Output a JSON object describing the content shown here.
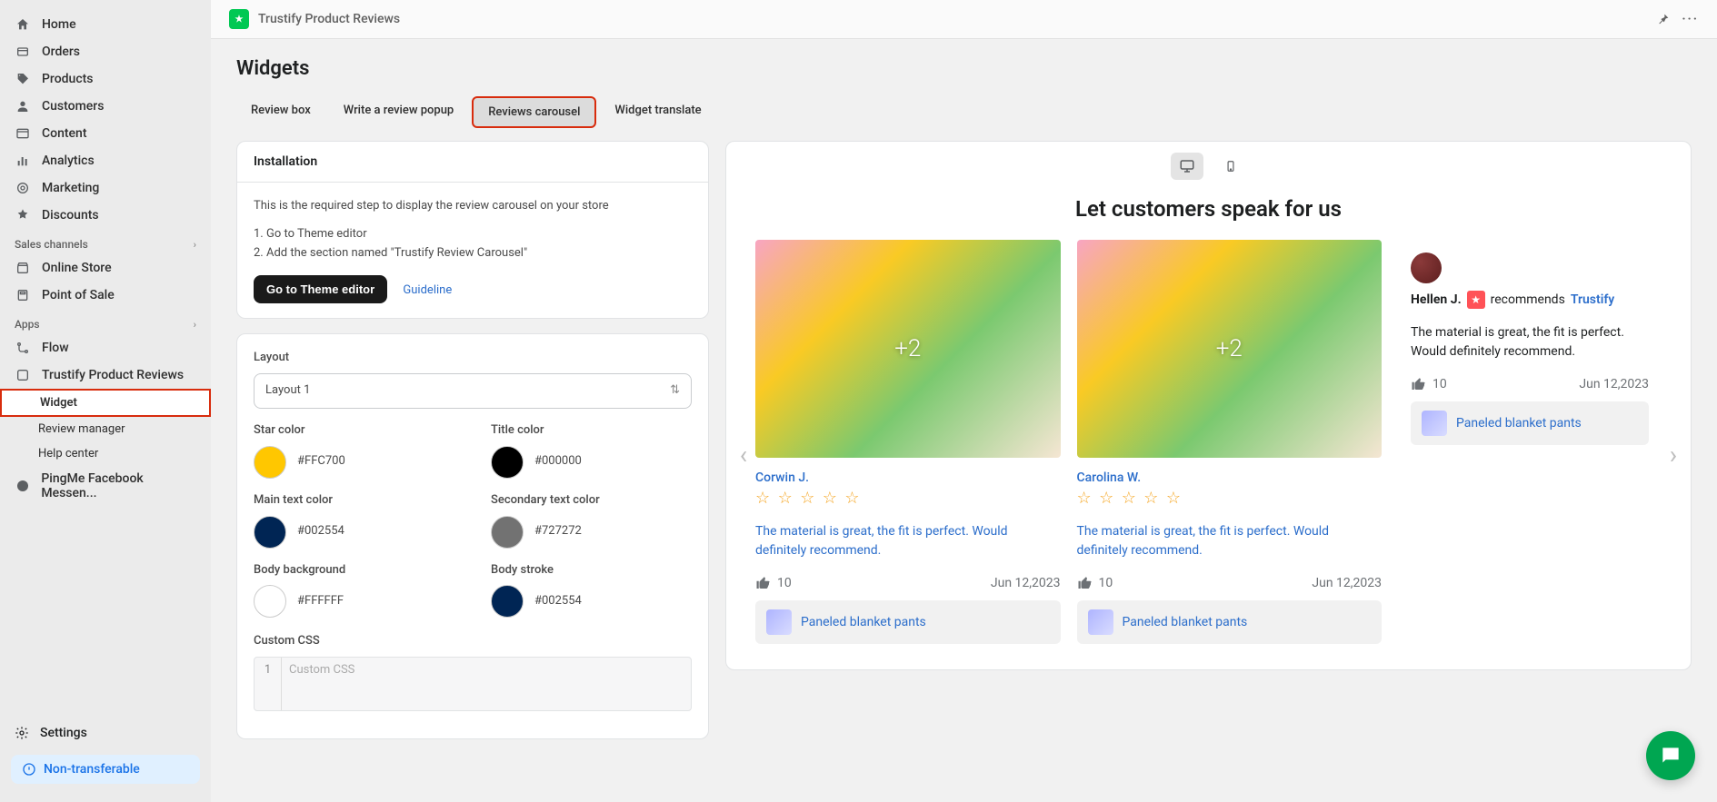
{
  "app": {
    "title": "Trustify Product Reviews"
  },
  "sidebar": {
    "items": [
      {
        "label": "Home"
      },
      {
        "label": "Orders"
      },
      {
        "label": "Products"
      },
      {
        "label": "Customers"
      },
      {
        "label": "Content"
      },
      {
        "label": "Analytics"
      },
      {
        "label": "Marketing"
      },
      {
        "label": "Discounts"
      }
    ],
    "sections": {
      "sales_channels": "Sales channels",
      "apps": "Apps"
    },
    "channels": [
      {
        "label": "Online Store"
      },
      {
        "label": "Point of Sale"
      }
    ],
    "apps": [
      {
        "label": "Flow"
      },
      {
        "label": "Trustify Product Reviews",
        "children": [
          {
            "label": "Widget",
            "highlighted": true
          },
          {
            "label": "Review manager"
          },
          {
            "label": "Help center"
          }
        ]
      },
      {
        "label": "PingMe Facebook Messen..."
      }
    ],
    "settings": "Settings",
    "non_transferable": "Non-transferable"
  },
  "page": {
    "title": "Widgets"
  },
  "tabs": [
    {
      "label": "Review box"
    },
    {
      "label": "Write a review popup"
    },
    {
      "label": "Reviews carousel",
      "active": true
    },
    {
      "label": "Widget translate"
    }
  ],
  "installation": {
    "title": "Installation",
    "desc": "This is the required step to display the review carousel on your store",
    "step1": "1. Go to Theme editor",
    "step2": "2. Add the section named \"Trustify Review Carousel\"",
    "button": "Go to Theme editor",
    "guideline": "Guideline"
  },
  "layout": {
    "label": "Layout",
    "value": "Layout 1",
    "colors": {
      "star": {
        "label": "Star color",
        "hex": "#FFC700"
      },
      "title": {
        "label": "Title color",
        "hex": "#000000"
      },
      "main": {
        "label": "Main text color",
        "hex": "#002554"
      },
      "second": {
        "label": "Secondary text color",
        "hex": "#727272"
      },
      "bodybg": {
        "label": "Body background",
        "hex": "#FFFFFF"
      },
      "stroke": {
        "label": "Body stroke",
        "hex": "#002554"
      }
    },
    "custom_css_label": "Custom CSS",
    "custom_css_placeholder": "Custom CSS"
  },
  "preview": {
    "heading": "Let customers speak for us",
    "img_badge": "+2",
    "reviews": [
      {
        "name": "Corwin J.",
        "text": "The material is great, the fit is perfect. Would definitely recommend.",
        "likes": "10",
        "date": "Jun 12,2023",
        "product": "Paneled blanket pants"
      },
      {
        "name": "Carolina W.",
        "text": "The material is great, the fit is perfect. Would definitely recommend.",
        "likes": "10",
        "date": "Jun 12,2023",
        "product": "Paneled blanket pants"
      }
    ],
    "compact": {
      "name": "Hellen J.",
      "recommends": "recommends",
      "brand": "Trustify",
      "text": "The material is great, the fit is perfect. Would definitely recommend.",
      "likes": "10",
      "date": "Jun 12,2023",
      "product": "Paneled blanket pants"
    }
  }
}
